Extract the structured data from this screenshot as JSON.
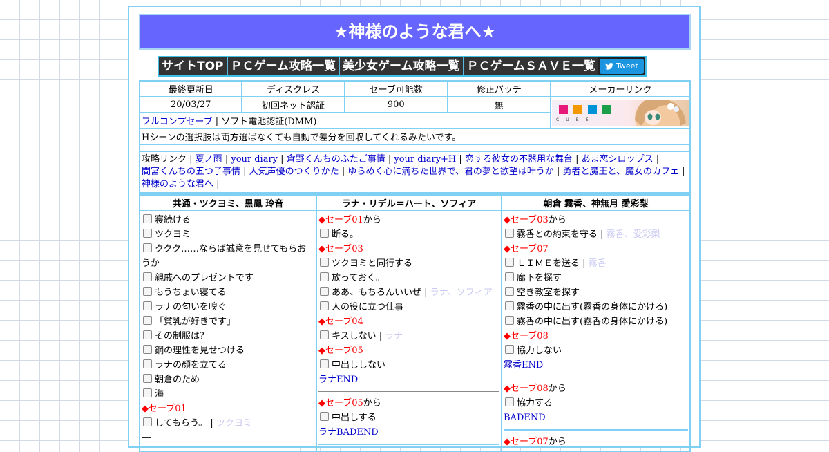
{
  "title": "★神様のような君へ★",
  "nav": {
    "items": [
      "サイトTOP",
      "ＰＣゲーム攻略一覧",
      "美少女ゲーム攻略一覧",
      "ＰＣゲームＳＡＶＥ一覧"
    ],
    "tweet_label": "Tweet"
  },
  "info": {
    "headers": [
      "最終更新日",
      "ディスクレス",
      "セーブ可能数",
      "修正パッチ",
      "メーカーリンク"
    ],
    "values": [
      "20/03/27",
      "初回ネット認証",
      "900",
      "無"
    ],
    "fullcomp_link": "フルコンプセーブ",
    "fullcomp_rest": "ソフト電池認証(DMM)",
    "note": "Hシーンの選択肢は両方選ばなくても自動で差分を回収してくれるみたいです。",
    "banner_text": "CUBE",
    "links_label": "攻略リンク",
    "links": [
      "夏ノ雨",
      "your diary",
      "倉野くんちのふたご事情",
      "your diary+H",
      "恋する彼女の不器用な舞台",
      "あま恋シロップス",
      "間宮くんちの五つ子事情",
      "人気声優のつくりかた",
      "ゆらめく心に満ちた世界で、君の夢と欲望は叶うか",
      "勇者と魔王と、魔女のカフェ",
      "神様のような君へ"
    ]
  },
  "routes": {
    "headers": [
      "共通・ツクヨミ、黒鳳 玲音",
      "ラナ・リデル＝ハート、ソフィア",
      "朝倉 霧香、神無月 愛彩梨"
    ],
    "col1": {
      "choices": [
        "寝続ける",
        "ツクヨミ",
        "ククク……ならば誠意を見せてもらおうか",
        "親戚へのプレゼントです",
        "もうちょい寝てる",
        "ラナの匂いを嗅ぐ",
        "「貧乳が好きです」",
        "その制服は？",
        "鋼の理性を見せつける",
        "ラナの顔を立てる",
        "朝倉のため",
        "海"
      ],
      "save01": "セーブ01",
      "last_choice": "してもらう。",
      "last_tag": "ツクヨミ",
      "dash": "―"
    },
    "col2": {
      "save01": "セーブ01",
      "kara": "から",
      "c1": "断る。",
      "save03": "セーブ03",
      "c2": "ツクヨミと同行する",
      "c3": "放っておく。",
      "c4": "ああ、もちろんいいぜ",
      "c4_tag": "ラナ、ソフィア",
      "c5": "人の役に立つ仕事",
      "save04": "セーブ04",
      "c6": "キスしない",
      "c6_tag": "ラナ",
      "save05": "セーブ05",
      "c7": "中出ししない",
      "end1": "ラナEND",
      "save05b": "セーブ05",
      "c8": "中出しする",
      "end2": "ラナBADEND"
    },
    "col3": {
      "save03": "セーブ03",
      "kara": "から",
      "c1": "霧香との約束を守る",
      "c1_tag": "霧香、愛彩梨",
      "save07": "セーブ07",
      "c2": "ＬＩＭＥを送る",
      "c2_tag": "霧香",
      "c3": "廊下を探す",
      "c4": "空き教室を探す",
      "c5": "霧香の中に出す(霧香の身体にかける)",
      "c6": "霧香の中に出す(霧香の身体にかける)",
      "save08": "セーブ08",
      "c7": "協力しない",
      "end1": "霧香END",
      "save08b": "セーブ08",
      "c8": "協力する",
      "end2": "BADEND",
      "save07b": "セーブ07"
    }
  },
  "colors": {
    "title_bg": "#6666ff",
    "border": "#7fd0f2",
    "save": "#ff0000",
    "link": "#0000cc"
  }
}
